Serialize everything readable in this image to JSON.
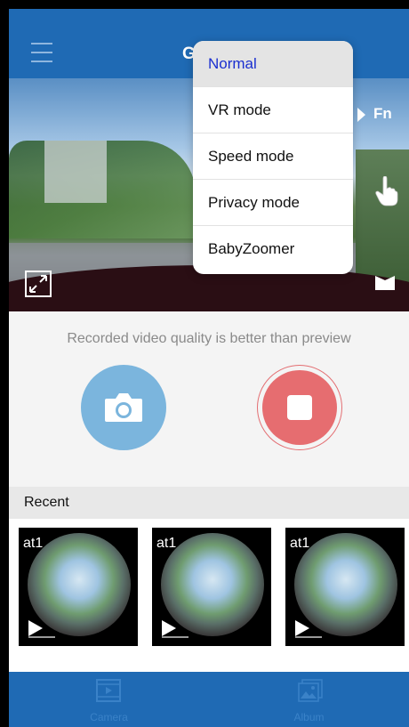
{
  "header": {
    "title": "G"
  },
  "preview": {
    "fn_label": "Fn"
  },
  "fn_menu": {
    "items": [
      {
        "label": "Normal",
        "selected": true
      },
      {
        "label": "VR mode",
        "selected": false
      },
      {
        "label": "Speed mode",
        "selected": false
      },
      {
        "label": "Privacy mode",
        "selected": false
      },
      {
        "label": "BabyZoomer",
        "selected": false
      }
    ]
  },
  "controls": {
    "quality_note": "Recorded video quality is better than preview"
  },
  "recent": {
    "label": "Recent",
    "thumbnails": [
      {
        "name": "at1"
      },
      {
        "name": "at1"
      },
      {
        "name": "at1"
      }
    ]
  },
  "bottom_nav": {
    "tabs": [
      {
        "label": "Camera",
        "icon": "camera-film-icon"
      },
      {
        "label": "Album",
        "icon": "album-icon"
      }
    ]
  },
  "colors": {
    "header": "#1f6ab4",
    "photo_button": "#7bb5dd",
    "record_button": "#e66d70",
    "selected_text": "#1a2fd0"
  }
}
